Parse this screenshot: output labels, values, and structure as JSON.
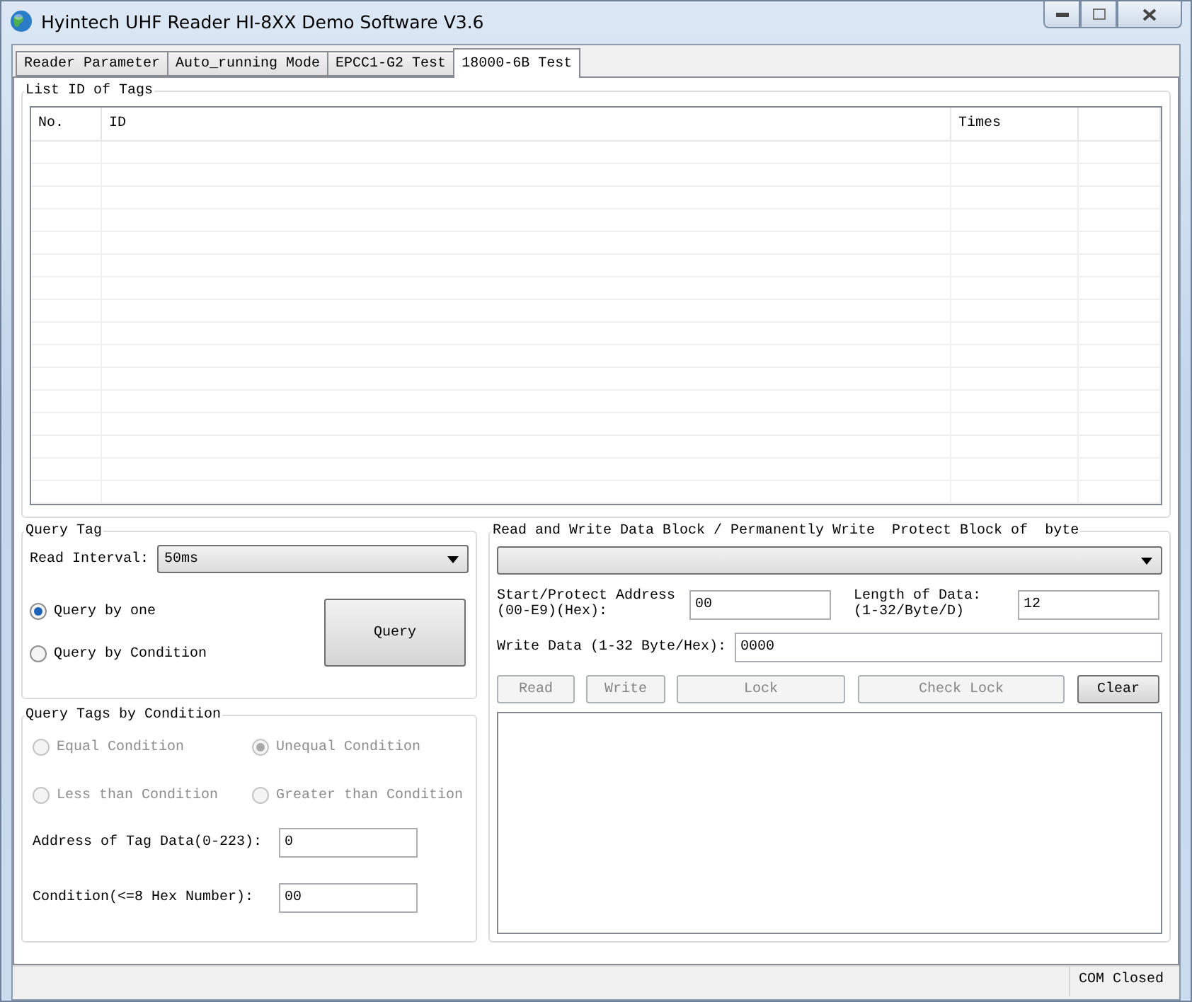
{
  "window": {
    "title": "Hyintech UHF Reader HI-8XX Demo Software V3.6"
  },
  "tabs": [
    {
      "label": "Reader Parameter",
      "selected": false
    },
    {
      "label": "Auto_running Mode",
      "selected": false
    },
    {
      "label": "EPCC1-G2 Test",
      "selected": false
    },
    {
      "label": "18000-6B Test",
      "selected": true
    }
  ],
  "tag_list": {
    "title": "List ID of Tags",
    "columns": [
      "No.",
      "ID",
      "Times"
    ]
  },
  "query_tag": {
    "title": "Query Tag",
    "read_interval_label": "Read Interval:",
    "read_interval": "50ms",
    "modes": [
      {
        "label": "Query by one",
        "selected": true
      },
      {
        "label": "Query by Condition",
        "selected": false
      }
    ],
    "query_button": "Query"
  },
  "condition": {
    "title": "Query Tags by Condition",
    "options": [
      {
        "label": "Equal Condition",
        "selected": false,
        "disabled": true
      },
      {
        "label": "Unequal Condition",
        "selected": true,
        "disabled": true
      },
      {
        "label": "Less than Condition",
        "selected": false,
        "disabled": true
      },
      {
        "label": "Greater than Condition",
        "selected": false,
        "disabled": true
      }
    ],
    "fields": [
      {
        "label": "Address of Tag Data(0-223):",
        "value": "0"
      },
      {
        "label": "Condition(<=8 Hex Number):",
        "value": "00"
      }
    ]
  },
  "block": {
    "title": "Read and Write Data Block / Permanently Write  Protect Block of  byte",
    "start_label": "Start/Protect Address\n(00-E9)(Hex):",
    "start_value": "00",
    "length_label": "Length of Data:\n(1-32/Byte/D)",
    "length_value": "12",
    "write_label": "Write Data (1-32 Byte/Hex):",
    "write_value": "0000",
    "buttons": [
      {
        "label": "Read",
        "disabled": true
      },
      {
        "label": "Write",
        "disabled": true
      },
      {
        "label": "Lock",
        "disabled": true
      },
      {
        "label": "Check Lock",
        "disabled": true
      },
      {
        "label": "Clear",
        "disabled": false
      }
    ]
  },
  "status_bar": {
    "text": "COM Closed"
  }
}
